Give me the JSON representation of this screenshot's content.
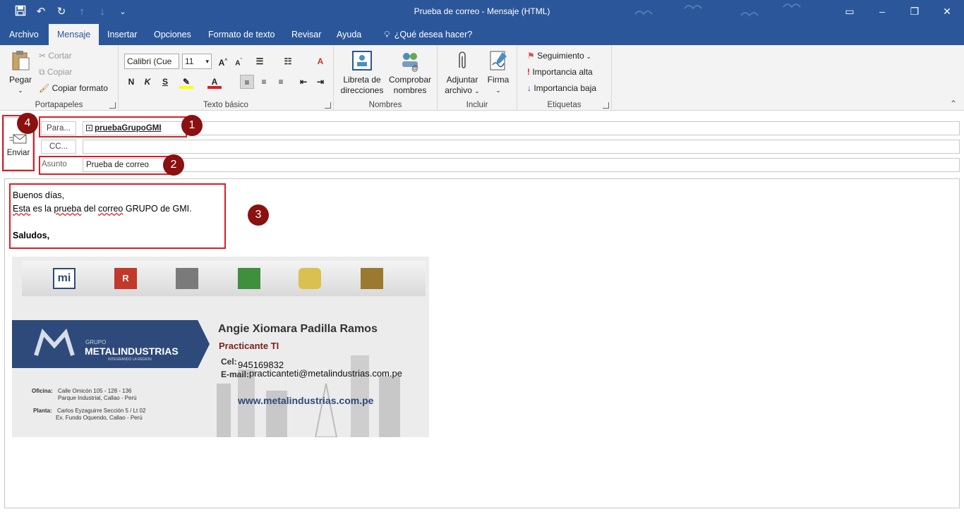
{
  "window": {
    "title": "Prueba de correo  -  Mensaje (HTML)"
  },
  "tabs": [
    {
      "label": "Archivo"
    },
    {
      "label": "Mensaje"
    },
    {
      "label": "Insertar"
    },
    {
      "label": "Opciones"
    },
    {
      "label": "Formato de texto"
    },
    {
      "label": "Revisar"
    },
    {
      "label": "Ayuda"
    },
    {
      "label": "¿Qué desea hacer?"
    }
  ],
  "ribbon": {
    "portapapeles": {
      "label": "Portapapeles",
      "pegar": "Pegar",
      "cortar": "Cortar",
      "copiar": "Copiar",
      "copiar_formato": "Copiar formato"
    },
    "texto_basico": {
      "label": "Texto básico",
      "font_name": "Calibri (Cue",
      "font_size": "11",
      "bold": "N",
      "italic": "K",
      "underline": "S"
    },
    "nombres": {
      "label": "Nombres",
      "libreta_1": "Libreta de",
      "libreta_2": "direcciones",
      "comprobar_1": "Comprobar",
      "comprobar_2": "nombres"
    },
    "incluir": {
      "label": "Incluir",
      "adjuntar_1": "Adjuntar",
      "adjuntar_2": "archivo",
      "firma": "Firma"
    },
    "etiquetas": {
      "label": "Etiquetas",
      "seguimiento": "Seguimiento",
      "importancia_alta": "Importancia alta",
      "importancia_baja": "Importancia baja"
    }
  },
  "header": {
    "enviar": "Enviar",
    "para_label": "Para...",
    "para_value": "pruebaGrupoGMI",
    "cc_label": "CC...",
    "cc_value": "",
    "asunto_label": "Asunto",
    "asunto_value": "Prueba de correo"
  },
  "body": {
    "greeting": "Buenos días,",
    "line_part1": "Esta",
    "line_part2": " es la ",
    "line_part3": "prueba",
    "line_part4": " del ",
    "line_part5": "correo",
    "line_part6": " GRUPO de GMI.",
    "closing": "Saludos,"
  },
  "annotations": [
    "1",
    "2",
    "3",
    "4"
  ],
  "signature": {
    "brand_small": "GRUPO",
    "brand": "METALINDUSTRIAS",
    "brand_tag": "INTEGRANDO LA REGION",
    "name": "Angie Xiomara Padilla Ramos",
    "role": "Practicante TI",
    "cel_label": "Cel:",
    "cel_value": "945169832",
    "email_label": "E-mail:",
    "email_value": "practicanteti@metalindustrias.com.pe",
    "oficina_label": "Oficina:",
    "oficina_1": "Calle Omicón 105 - 128 - 136",
    "oficina_2": "Parque Industrial, Callao - Perú",
    "planta_label": "Planta:",
    "planta_1": "Carlos Eyzaguirre Sección 5 / Lt 02",
    "planta_2": "Ex. Fundo Oquendo, Callao - Perú",
    "web": "www.metalindustrias.com.pe",
    "logos": [
      "mi",
      "R",
      "",
      "",
      "",
      ""
    ]
  },
  "colors": {
    "brand_blue": "#2b579a",
    "annotation_red": "#d91f26",
    "badge_red": "#8b1010",
    "card_blue": "#2e4a7a",
    "role_color": "#7a2020"
  }
}
